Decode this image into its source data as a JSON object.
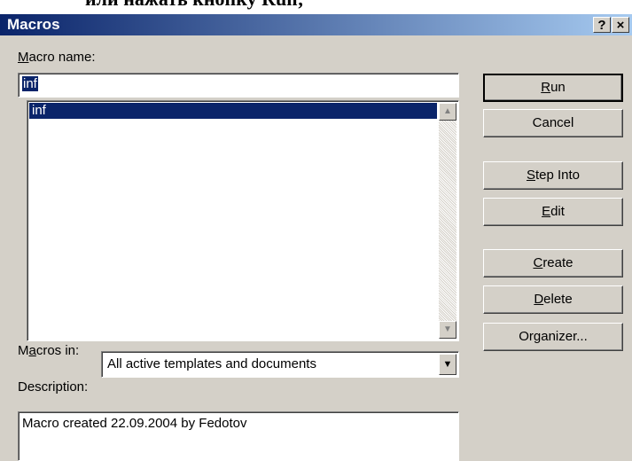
{
  "background_text": "или нажать кнопку Run;",
  "dialog": {
    "title": "Macros",
    "help_label": "?",
    "close_label": "×"
  },
  "macro_name": {
    "label_first": "M",
    "label_rest": "acro name:",
    "value": "inf"
  },
  "macro_list": {
    "items": [
      "inf"
    ],
    "selected_index": 0
  },
  "macros_in": {
    "label_first": "M",
    "label_accel": "a",
    "label_rest": "cros in:",
    "value": "All active templates and documents"
  },
  "description": {
    "label": "Description:",
    "value": "Macro created 22.09.2004 by Fedotov"
  },
  "buttons": {
    "run": {
      "pre": "",
      "acc": "R",
      "post": "un"
    },
    "cancel": {
      "pre": "Cancel",
      "acc": "",
      "post": ""
    },
    "step_into": {
      "pre": "",
      "acc": "S",
      "post": "tep Into"
    },
    "edit": {
      "pre": "",
      "acc": "E",
      "post": "dit"
    },
    "create": {
      "pre": "",
      "acc": "C",
      "post": "reate"
    },
    "delete": {
      "pre": "",
      "acc": "D",
      "post": "elete"
    },
    "organizer": {
      "pre": "Or",
      "acc": "g",
      "post": "anizer..."
    }
  },
  "colors": {
    "selection": "#0a246a",
    "face": "#d4d0c8"
  },
  "icons": {
    "scroll_up": "up-arrow-icon",
    "scroll_down": "down-arrow-icon",
    "combo_dropdown": "down-arrow-icon"
  }
}
